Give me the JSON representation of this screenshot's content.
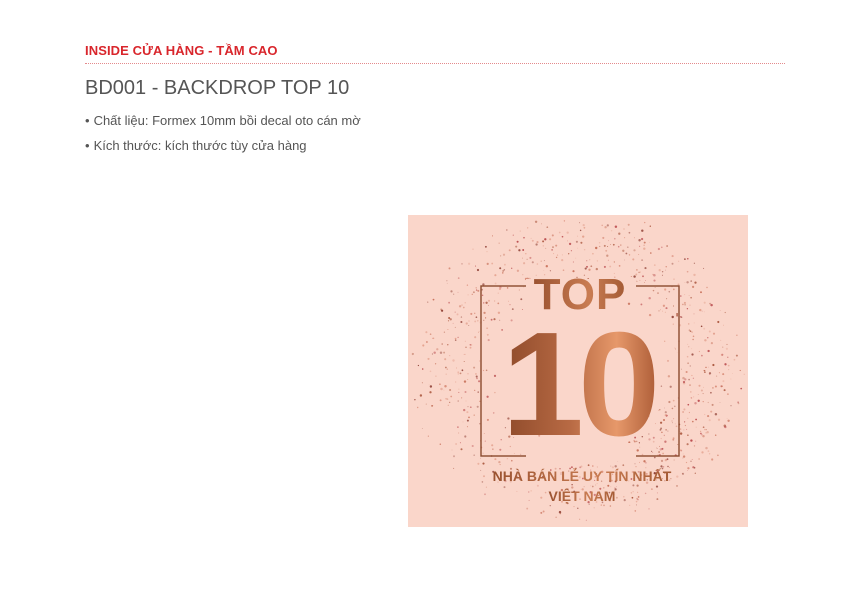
{
  "section": {
    "label": "INSIDE CỬA HÀNG - TẦM CAO"
  },
  "product": {
    "title": "BD001 - BACKDROP TOP 10",
    "specs": [
      {
        "bullet": "•",
        "text": "Chất liệu: Formex 10mm bồi decal oto cán mờ"
      },
      {
        "bullet": "•",
        "text": "Kích thước: kích thước tùy cửa hàng"
      }
    ]
  },
  "backdrop_art": {
    "word_top": "TOP",
    "number": "10",
    "line1": "NHÀ BÁN LẺ UY TÍN NHẤT",
    "line2": "VIỆT NAM"
  },
  "colors": {
    "accent_red": "#d9262c",
    "text_gray": "#555555",
    "backdrop_pink": "#fad6ca",
    "copper_dark": "#8e4a2a",
    "copper_light": "#e6986a"
  }
}
